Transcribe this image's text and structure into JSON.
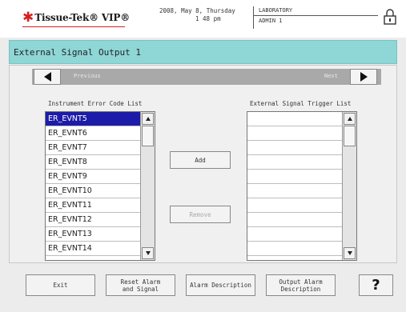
{
  "header": {
    "brand": "Tissue-Tek® VIP®",
    "date_line1": "2008, May 8, Thursday",
    "date_line2": "1 48 pm",
    "location": "LABORATORY",
    "user": "ADMIN 1"
  },
  "title": "External Signal Output 1",
  "nav": {
    "previous_label": "Previous",
    "next_label": "Next"
  },
  "left_list": {
    "title": "Instrument Error Code List",
    "items": [
      "ER_EVNT5",
      "ER_EVNT6",
      "ER_EVNT7",
      "ER_EVNT8",
      "ER_EVNT9",
      "ER_EVNT10",
      "ER_EVNT11",
      "ER_EVNT12",
      "ER_EVNT13",
      "ER_EVNT14"
    ],
    "selected": "ER_EVNT5"
  },
  "right_list": {
    "title": "External Signal Trigger List",
    "items": [
      "",
      "",
      "",
      "",
      "",
      "",
      "",
      "",
      "",
      ""
    ]
  },
  "buttons": {
    "add": "Add",
    "remove": "Remove",
    "exit": "Exit",
    "reset_line1": "Reset Alarm",
    "reset_line2": "and Signal",
    "alarm_description": "Alarm Description",
    "output_line1": "Output Alarm",
    "output_line2": "Description",
    "help": "?"
  },
  "icons": {
    "logo": "star-icon",
    "lock": "lock-icon",
    "prev": "triangle-left-icon",
    "next": "triangle-right-icon",
    "scroll_up": "arrow-up-icon",
    "scroll_down": "arrow-down-icon"
  },
  "colors": {
    "title_bar": "#8fd6d6",
    "selection": "#1c1ca8",
    "logo_red": "#d42020"
  }
}
